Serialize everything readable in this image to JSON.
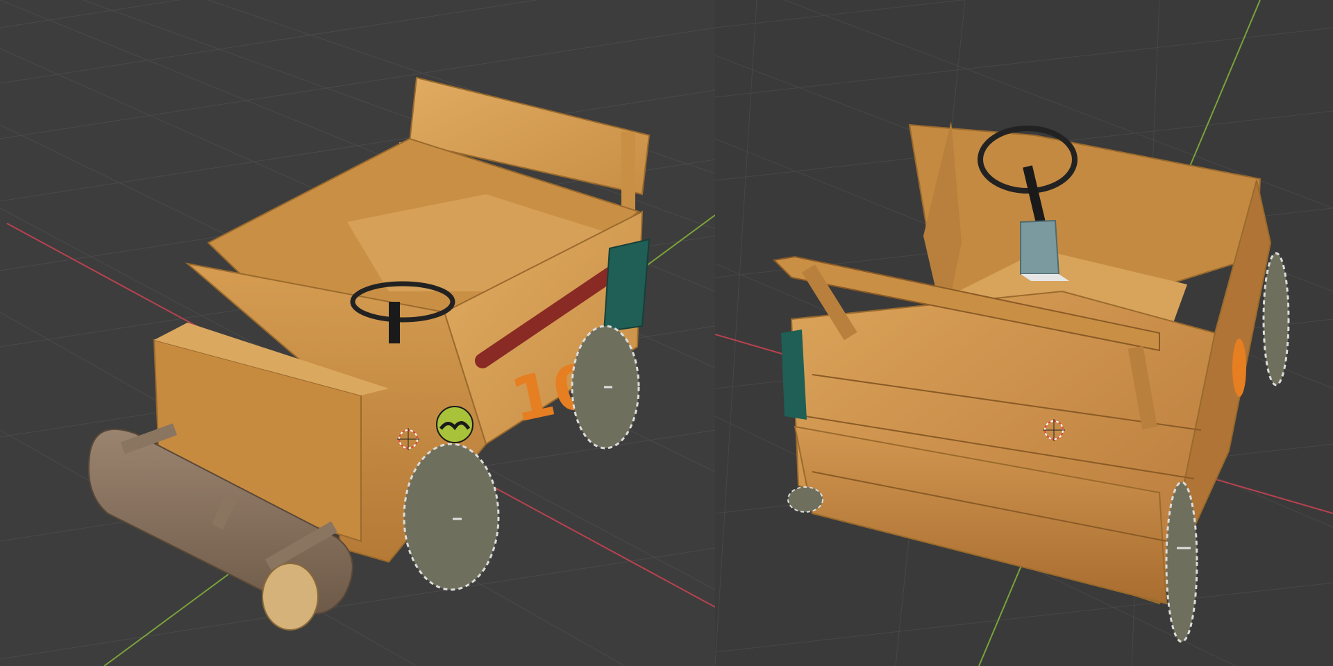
{
  "scene": {
    "background_color": "#3d3d3d",
    "grid_color": "#4a4a4a",
    "x_axis_color": "#b8424f",
    "y_axis_color": "#7aa33a",
    "left_view": {
      "car_number": "10",
      "emblem": "bat-emblem",
      "objects": [
        "wooden-car",
        "log-bumper",
        "saw-blade-wheel",
        "steering-wheel",
        "baseball-bat",
        "green-panel",
        "origin-cursor"
      ]
    },
    "right_view": {
      "objects": [
        "wooden-car",
        "saw-blade-wheel",
        "steering-wheel",
        "gear-lever",
        "origin-cursor"
      ]
    }
  },
  "colors": {
    "wood_light": "#d9a35a",
    "wood_mid": "#c98f45",
    "wood_dark": "#a8702e",
    "log": "#8a7560",
    "blade": "#6e6f5c",
    "number": "#e67e22",
    "emblem_bg": "#a8c23a",
    "bat": "#8a2a24",
    "green_panel": "#1f5f55",
    "lever_base": "#7a9aa0"
  }
}
